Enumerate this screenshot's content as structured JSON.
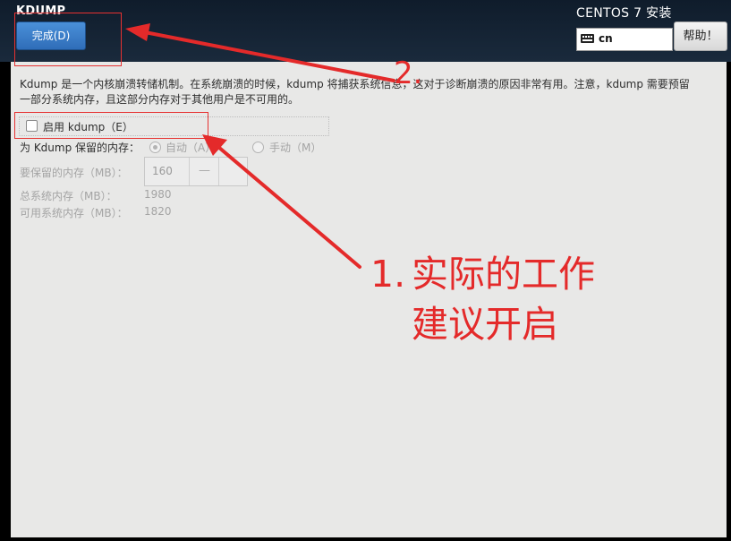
{
  "header": {
    "spoke_title": "KDUMP",
    "done_button": "完成(D)",
    "product_title": "CENTOS 7 安装",
    "keyboard_layout": "cn",
    "help_button": "帮助！"
  },
  "content": {
    "description": "Kdump 是一个内核崩溃转储机制。在系统崩溃的时候，kdump 将捕获系统信息，这对于诊断崩溃的原因非常有用。注意，kdump 需要预留\n一部分系统内存，且这部分内存对于其他用户是不可用的。",
    "enable_label": "启用 kdump（E）",
    "enable_checked": false,
    "reserve_label": "为 Kdump 保留的内存：",
    "reserve_auto": "自动（A）",
    "reserve_manual": "手动（M）",
    "reserve_mode": "auto",
    "reserved_memory_label": "要保留的内存（MB）：",
    "reserved_memory_value": "160",
    "spin_minus": "—",
    "total_memory_label": "总系统内存（MB）：",
    "total_memory_value": "1980",
    "usable_memory_label": "可用系统内存（MB）：",
    "usable_memory_value": "1820"
  },
  "annotations": {
    "number_1": "1.",
    "text_1": "实际的工作\n建议开启",
    "number_2": "2.",
    "color": "#e42a2a"
  }
}
